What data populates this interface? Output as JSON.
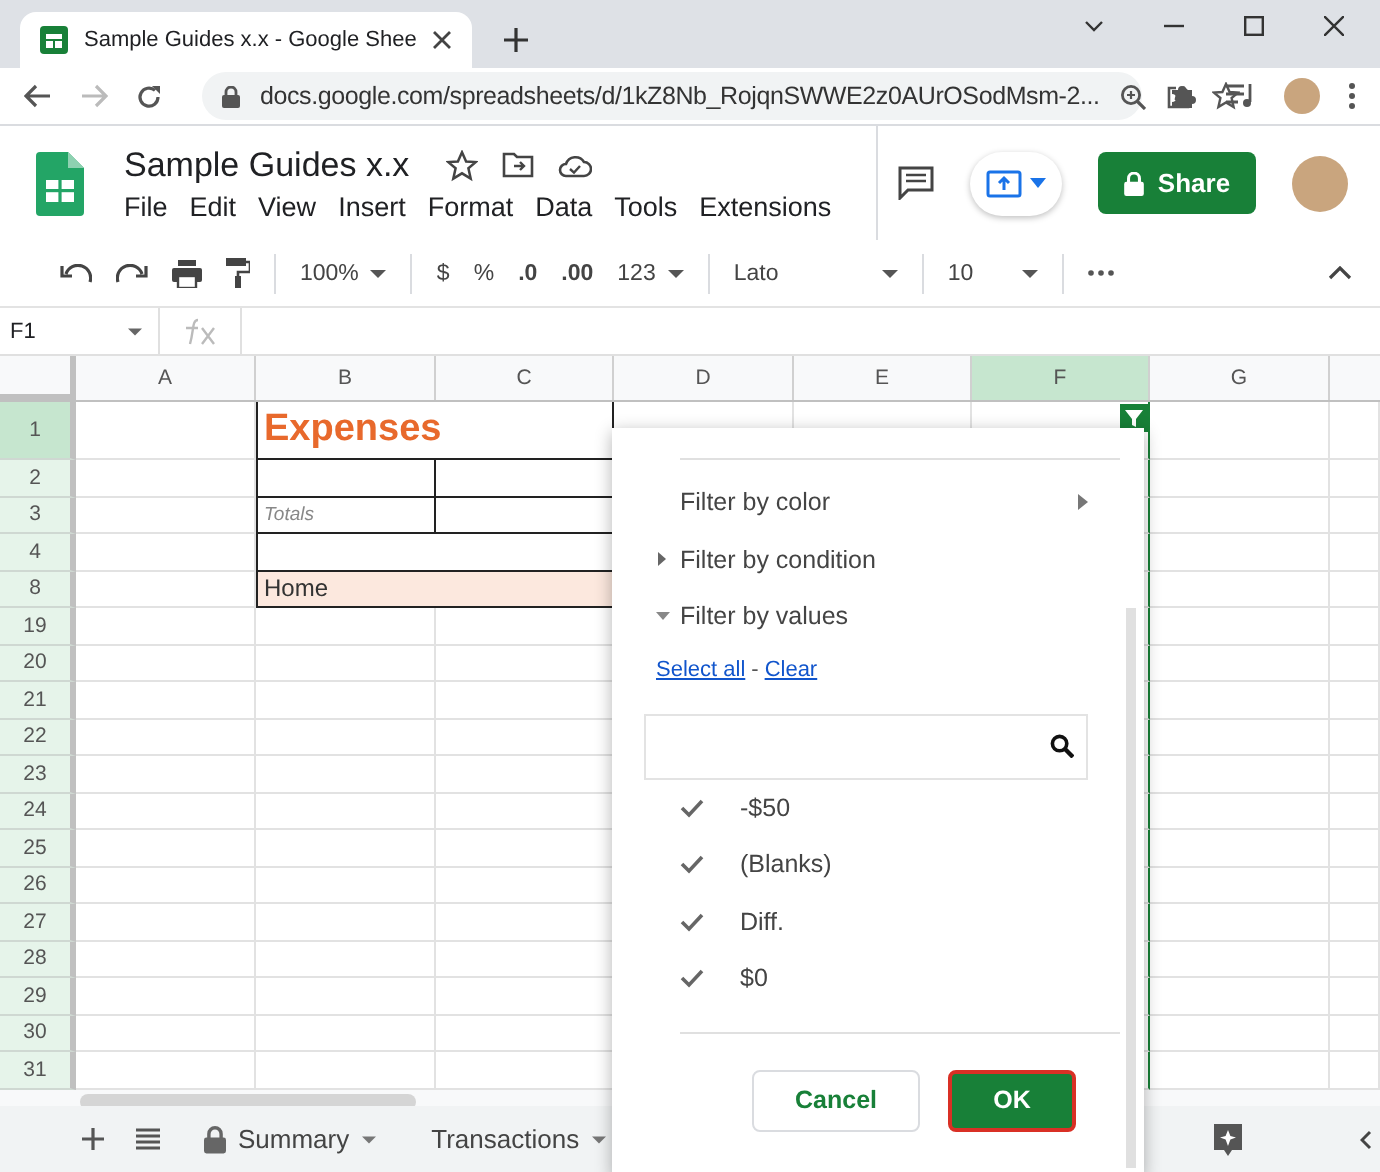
{
  "browser": {
    "tab_title": "Sample Guides x.x - Google Shee",
    "url": "docs.google.com/spreadsheets/d/1kZ8Nb_RojqnSWWE2z0AUrOSodMsm-2..."
  },
  "document": {
    "title": "Sample Guides x.x",
    "menu": [
      "File",
      "Edit",
      "View",
      "Insert",
      "Format",
      "Data",
      "Tools",
      "Extensions"
    ],
    "share": "Share"
  },
  "toolbar": {
    "zoom": "100%",
    "currency": "$",
    "percent": "%",
    "decrease_decimals": ".0",
    "increase_decimals": ".00",
    "number_format": "123",
    "font": "Lato",
    "font_size": "10"
  },
  "name_box": "F1",
  "columns": [
    {
      "label": "A",
      "selected": false
    },
    {
      "label": "B",
      "selected": false
    },
    {
      "label": "C",
      "selected": false
    },
    {
      "label": "D",
      "selected": false
    },
    {
      "label": "E",
      "selected": false
    },
    {
      "label": "F",
      "selected": true
    },
    {
      "label": "G",
      "selected": false
    }
  ],
  "rows": [
    {
      "label": "1",
      "selected": true,
      "content": {
        "text": "Expenses",
        "kind": "title",
        "merged": true
      }
    },
    {
      "label": "2",
      "selected": false,
      "content": {
        "kind": "boxed",
        "merged": false
      }
    },
    {
      "label": "3",
      "selected": false,
      "content": {
        "text": "Totals",
        "kind": "note",
        "merged": false
      }
    },
    {
      "label": "4",
      "selected": false,
      "content": {
        "kind": "boxed",
        "merged": true
      }
    },
    {
      "label": "8",
      "selected": false,
      "content": {
        "text": "Home",
        "kind": "highlight",
        "merged": true
      }
    },
    {
      "label": "19",
      "selected": false
    },
    {
      "label": "20",
      "selected": false
    },
    {
      "label": "21",
      "selected": false
    },
    {
      "label": "22",
      "selected": false
    },
    {
      "label": "23",
      "selected": false
    },
    {
      "label": "24",
      "selected": false
    },
    {
      "label": "25",
      "selected": false
    },
    {
      "label": "26",
      "selected": false
    },
    {
      "label": "27",
      "selected": false
    },
    {
      "label": "28",
      "selected": false
    },
    {
      "label": "29",
      "selected": false
    },
    {
      "label": "30",
      "selected": false
    },
    {
      "label": "31",
      "selected": false
    }
  ],
  "filter_menu": {
    "sections": [
      {
        "label": "Filter by color",
        "kind": "submenu"
      },
      {
        "label": "Filter by condition",
        "kind": "collapsed"
      },
      {
        "label": "Filter by values",
        "kind": "expanded"
      }
    ],
    "select_all": "Select all",
    "separator": "-",
    "clear": "Clear",
    "values": [
      {
        "label": "-$50",
        "checked": true
      },
      {
        "label": "(Blanks)",
        "checked": true
      },
      {
        "label": "Diff.",
        "checked": true
      },
      {
        "label": "$0",
        "checked": true
      }
    ],
    "cancel": "Cancel",
    "ok": "OK"
  },
  "sheet_tabs": [
    {
      "label": "Summary",
      "locked": true
    },
    {
      "label": "Transactions",
      "locked": false
    }
  ]
}
